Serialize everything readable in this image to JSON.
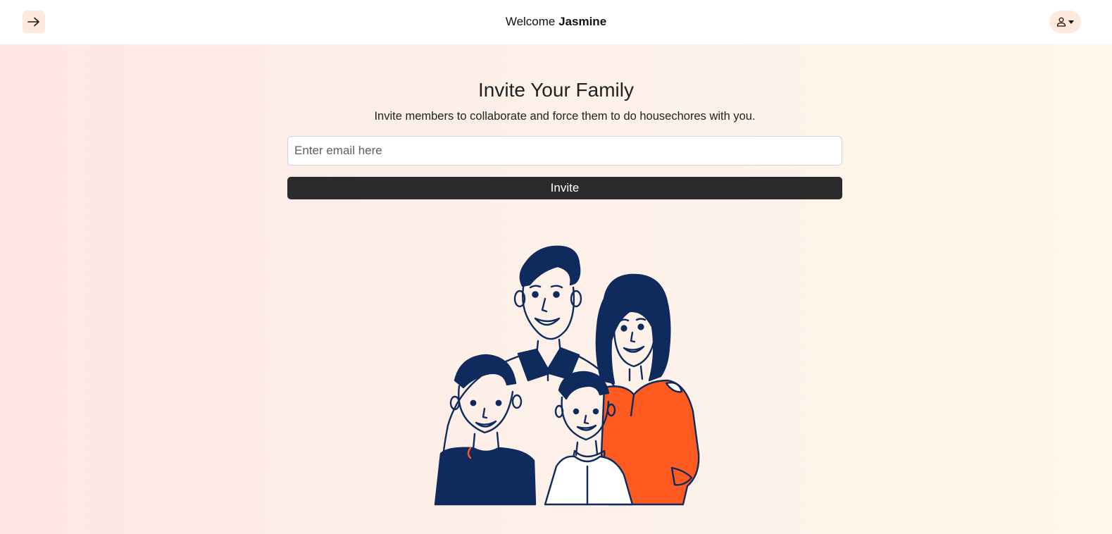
{
  "header": {
    "welcome_prefix": "Welcome",
    "user_name": "Jasmine",
    "back_icon": "arrow-right-icon",
    "user_icon": "person-icon"
  },
  "main": {
    "title": "Invite Your Family",
    "subtitle": "Invite members to collaborate and force them to do housechores with you.",
    "email_placeholder": "Enter email here",
    "email_value": "",
    "invite_label": "Invite"
  },
  "colors": {
    "accent_button_bg": "#ffe9dc",
    "primary_button": "#2b2b2d",
    "illustration_navy": "#0f2a5c",
    "illustration_orange": "#ff5a1f"
  }
}
